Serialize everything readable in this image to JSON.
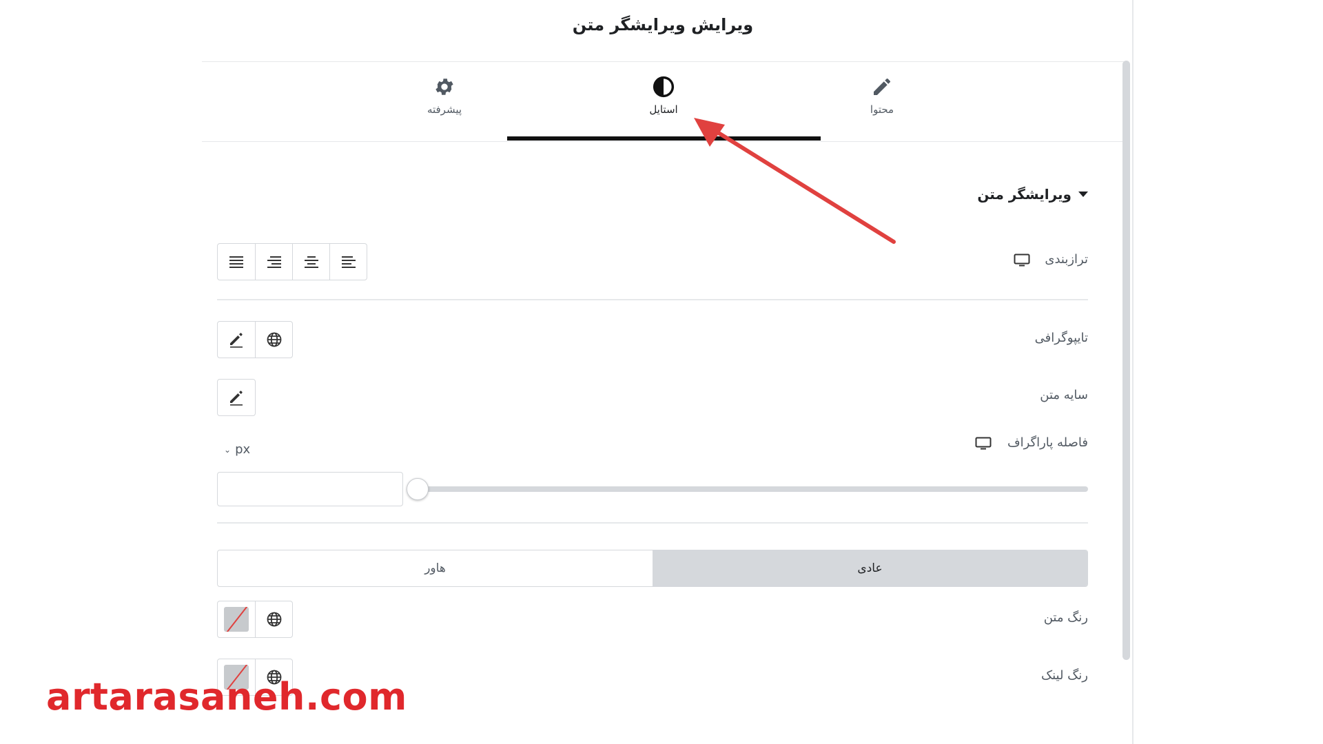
{
  "panel": {
    "title": "ویرایش ویرایشگر متن",
    "tabs": [
      {
        "label": "پیشرفته",
        "icon": "gear-icon",
        "active": false
      },
      {
        "label": "استایل",
        "icon": "contrast-icon",
        "active": true
      },
      {
        "label": "محتوا",
        "icon": "pencil-icon",
        "active": false
      }
    ],
    "section": {
      "title": "ویرایشگر متن"
    },
    "alignment": {
      "label": "ترازبندی",
      "options": [
        "justify",
        "right",
        "center",
        "left"
      ]
    },
    "typography": {
      "label": "تایپوگرافی"
    },
    "text_shadow": {
      "label": "سایه متن"
    },
    "paragraph_spacing": {
      "label": "فاصله پاراگراف",
      "unit": "px",
      "value": ""
    },
    "state_tabs": {
      "normal": "عادی",
      "hover": "هاور",
      "selected": "normal"
    },
    "text_color": {
      "label": "رنگ متن"
    },
    "link_color": {
      "label": "رنگ لینک"
    }
  },
  "annotation": {
    "arrow_color": "#e0413f"
  },
  "watermark": "artarasaneh.com"
}
